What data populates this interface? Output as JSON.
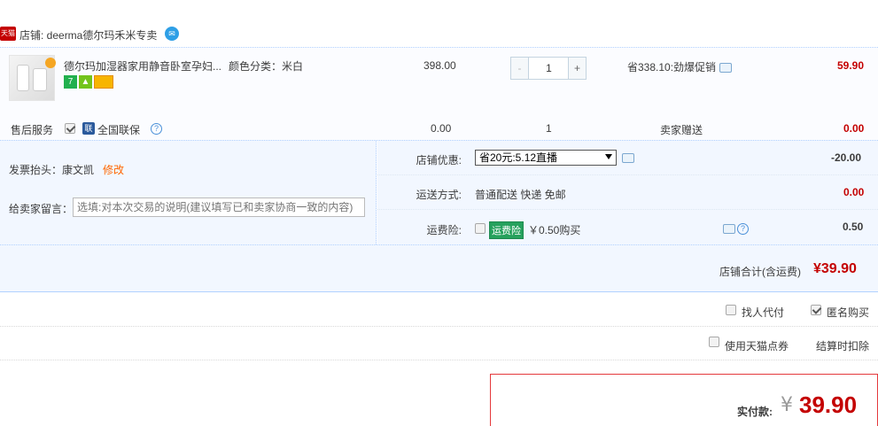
{
  "shop": {
    "badge": "天猫",
    "label": "店铺: deerma德尔玛禾米专卖",
    "ww_icon": "wangwang-chat-icon"
  },
  "item": {
    "title": "德尔玛加湿器家用静音卧室孕妇...",
    "spec": "颜色分类：米白",
    "badges": [
      "7",
      "android",
      "card"
    ],
    "unit_price": "398.00",
    "quantity": "1",
    "minus": "-",
    "plus": "+",
    "promo": "省338.10:劲爆促销",
    "total": "59.90"
  },
  "service": {
    "label": "售后服务",
    "guarantee_badge": "联",
    "guarantee": "全国联保",
    "help": "?",
    "price": "0.00",
    "qty": "1",
    "gift_label": "卖家赠送",
    "total": "0.00"
  },
  "invoice": {
    "label": "发票抬头：",
    "name": "康文凯",
    "edit": "修改"
  },
  "note": {
    "label": "给卖家留言：",
    "placeholder": "选填:对本次交易的说明(建议填写已和卖家协商一致的内容)"
  },
  "shop_discount": {
    "label": "店铺优惠:",
    "selected": "省20元:5.12直播",
    "value": "-20.00"
  },
  "shipping": {
    "label": "运送方式:",
    "method": "普通配送 快递 免邮",
    "value": "0.00"
  },
  "insurance": {
    "label": "运费险:",
    "tag": "运费险",
    "price": "￥0.50购买",
    "value": "0.50"
  },
  "shop_sum": {
    "label": "店铺合计(含运费)",
    "value": "¥39.90"
  },
  "options": {
    "proxy_pay": "找人代付",
    "anonymous": "匿名购买",
    "anonymous_checked": true,
    "tmall_points": "使用天猫点券",
    "settle_deduct": "结算时扣除"
  },
  "payment": {
    "label": "实付款:",
    "currency": "¥",
    "amount": "39.90"
  },
  "colors": {
    "price_red": "#c40000",
    "edit_orange": "#ff6600",
    "panel_blue": "#f2f7ff",
    "insurance_green": "#26a15d"
  }
}
